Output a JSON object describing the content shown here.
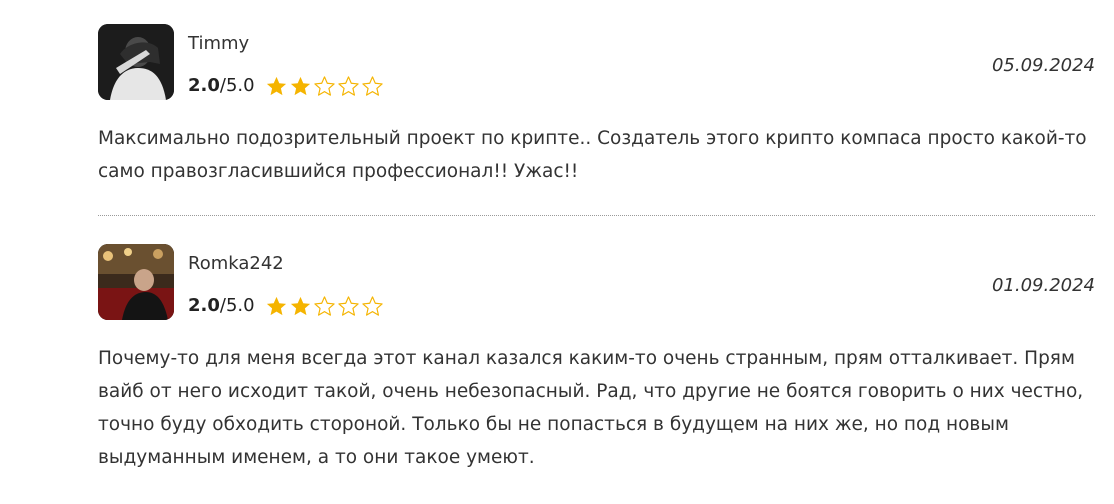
{
  "reviews": [
    {
      "author": "Timmy",
      "score": "2.0",
      "score_max": "/5.0",
      "stars_filled": 2,
      "stars_total": 5,
      "date": "05.09.2024",
      "text": "Максимально подозрительный проект по крипте.. Создатель этого крипто компаса просто какой-то само правозгласившийся профессионал!! Ужас!!"
    },
    {
      "author": "Romka242",
      "score": "2.0",
      "score_max": "/5.0",
      "stars_filled": 2,
      "stars_total": 5,
      "date": "01.09.2024",
      "text": "Почему-то для меня всегда этот канал казался каким-то очень странным, прям отталкивает. Прям вайб от него исходит такой, очень небезопасный. Рад, что другие не боятся говорить о них честно, точно буду обходить стороной. Только бы не попасться в будущем на них же, но под новым выдуманным именем, а то они такое умеют."
    }
  ],
  "colors": {
    "star_filled": "#f5b400",
    "star_empty_outline": "#f5b400",
    "text": "#333333",
    "divider": "#9a9a9a"
  },
  "icons": {
    "star": "star-icon",
    "avatar": "avatar"
  }
}
